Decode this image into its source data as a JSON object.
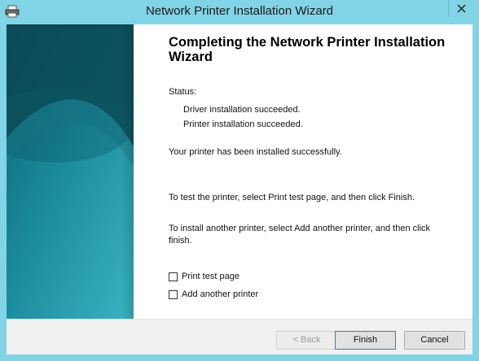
{
  "window": {
    "title": "Network Printer Installation Wizard"
  },
  "content": {
    "heading": "Completing the Network Printer Installation Wizard",
    "status_label": "Status:",
    "status_lines": [
      "Driver installation succeeded.",
      "Printer installation succeeded."
    ],
    "success_message": "Your printer has been installed successfully.",
    "test_instruction": "To test the printer, select Print test page, and then click Finish.",
    "add_instruction": "To install another printer, select Add another printer, and then click finish.",
    "checkboxes": [
      {
        "label": "Print test page",
        "checked": false
      },
      {
        "label": "Add another printer",
        "checked": false
      }
    ]
  },
  "footer": {
    "back_label": "< Back",
    "finish_label": "Finish",
    "cancel_label": "Cancel"
  },
  "colors": {
    "titlebar": "#81d4e6",
    "side_panel_dark": "#0b4f5c",
    "side_panel_light": "#2a9bab"
  }
}
